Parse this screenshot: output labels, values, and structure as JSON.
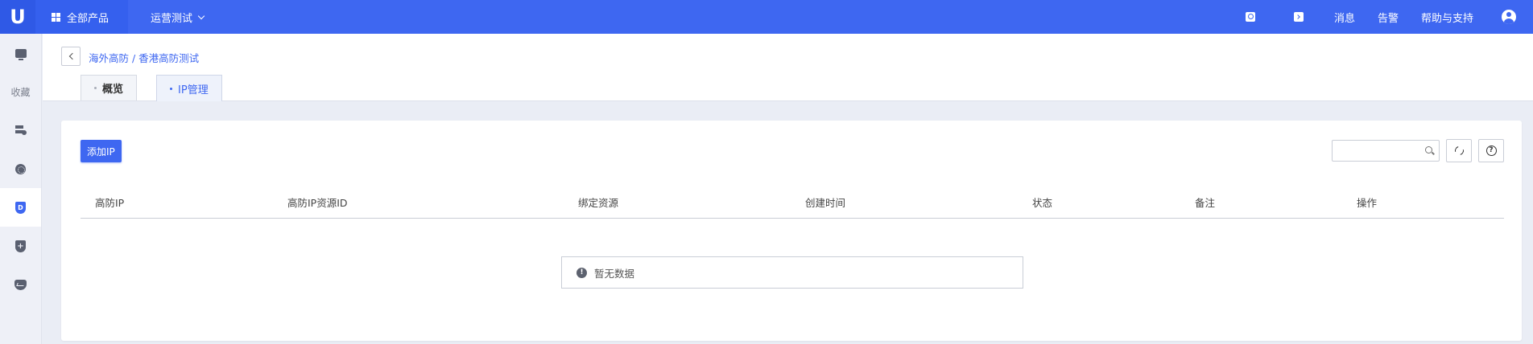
{
  "topbar": {
    "logo_text": "U",
    "all_products_label": "全部产品",
    "project_label": "运营测试",
    "links": [
      "消息",
      "告警",
      "帮助与支持"
    ],
    "accent_color": "#3e67f1",
    "icons": [
      "search-icon",
      "terminal-icon",
      "user-icon"
    ]
  },
  "sidebar": {
    "collect_label": "收藏",
    "items": [
      "monitor-icon",
      "server-icon",
      "network-icon",
      "ddos-shield-icon",
      "security-shield-icon",
      "health-icon"
    ]
  },
  "header": {
    "breadcrumb": "海外高防 / 香港高防测试",
    "tabs": [
      {
        "label": "概览",
        "active": false
      },
      {
        "label": "IP管理",
        "active": true
      }
    ]
  },
  "main": {
    "add_button_label": "添加IP",
    "search_placeholder": "",
    "columns": [
      "高防IP",
      "高防IP资源ID",
      "绑定资源",
      "创建时间",
      "状态",
      "备注",
      "操作"
    ],
    "rows": [],
    "empty_text": "暂无数据"
  }
}
